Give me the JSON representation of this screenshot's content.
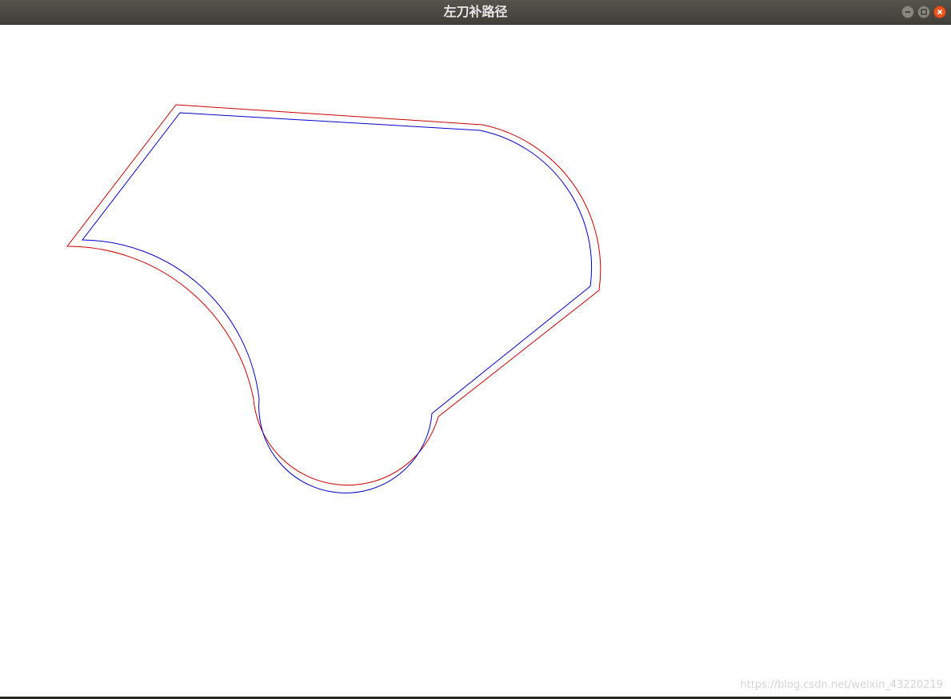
{
  "window": {
    "title": "左刀补路径"
  },
  "controls": {
    "minimize": "minimize-icon",
    "maximize": "maximize-icon",
    "close": "close-icon"
  },
  "paths": {
    "original_color": "#0000cc",
    "offset_color": "#cc0000"
  },
  "watermark": "https://blog.csdn.net/weixin_43220219"
}
